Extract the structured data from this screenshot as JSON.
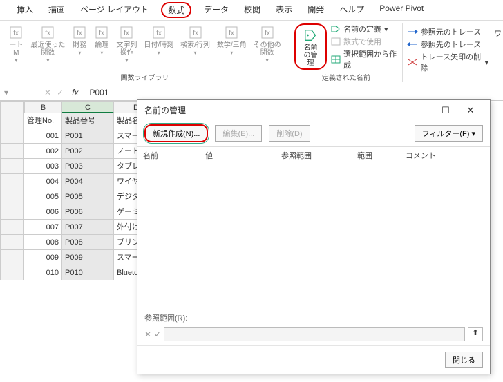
{
  "ribbon_tabs": [
    "挿入",
    "描画",
    "ページ レイアウト",
    "数式",
    "データ",
    "校閲",
    "表示",
    "開発",
    "ヘルプ",
    "Power Pivot"
  ],
  "highlight_tab_index": 3,
  "func_lib": {
    "items": [
      "ート\nM",
      "最近使った\n関数",
      "財務",
      "論理",
      "文字列\n操作",
      "日付/時刻",
      "検索/行列",
      "数学/三角",
      "その他の\n関数"
    ],
    "label": "関数ライブラリ"
  },
  "names_group": {
    "name_manager": "名前\nの管理",
    "define": "名前の定義",
    "use_in_formula": "数式で使用",
    "create_from_sel": "選択範囲から作成",
    "label": "定義された名前"
  },
  "audit_group": {
    "trace_prec": "参照元のトレース",
    "trace_dep": "参照先のトレース",
    "remove_arrows": "トレース矢印の削除",
    "watch": "ワ"
  },
  "formula_bar": {
    "name": "",
    "fx": "fx",
    "value": "P001"
  },
  "columns": [
    {
      "letter": "B",
      "w": 55
    },
    {
      "letter": "C",
      "w": 75,
      "sel": true
    },
    {
      "letter": "D",
      "w": 65
    }
  ],
  "headers": [
    "管理No.",
    "製品番号",
    "製品名"
  ],
  "rows": [
    {
      "no": "001",
      "code": "P001",
      "name": "スマート"
    },
    {
      "no": "002",
      "code": "P002",
      "name": "ノートパ"
    },
    {
      "no": "003",
      "code": "P003",
      "name": "タブレッ"
    },
    {
      "no": "004",
      "code": "P004",
      "name": "ワイヤレ"
    },
    {
      "no": "005",
      "code": "P005",
      "name": "デジタル"
    },
    {
      "no": "006",
      "code": "P006",
      "name": "ゲーミン"
    },
    {
      "no": "007",
      "code": "P007",
      "name": "外付けハ"
    },
    {
      "no": "008",
      "code": "P008",
      "name": "プリンタ"
    },
    {
      "no": "009",
      "code": "P009",
      "name": "スマート"
    },
    {
      "no": "010",
      "code": "P010",
      "name": "Bluetoot"
    }
  ],
  "dialog": {
    "title": "名前の管理",
    "new": "新規作成(N)...",
    "edit": "編集(E)...",
    "delete": "削除(D)",
    "filter": "フィルター(F)",
    "cols": {
      "name": "名前",
      "value": "値",
      "ref": "参照範囲",
      "scope": "範囲",
      "comment": "コメント"
    },
    "ref_label": "参照範囲(R):",
    "close": "閉じる"
  }
}
